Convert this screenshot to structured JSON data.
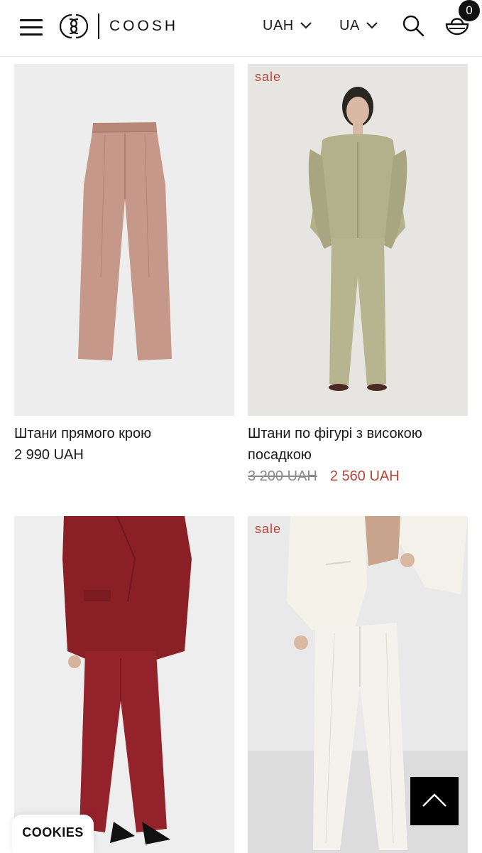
{
  "header": {
    "brand": "COOSH",
    "currency": "UAH",
    "language": "UA",
    "cart_count": "0"
  },
  "products": [
    {
      "name": "Штани прямого крою",
      "price": "2 990 UAH",
      "sale": false,
      "image": "dusty-pink-wide-trousers"
    },
    {
      "name": "Штани по фігурі з високою посадкою",
      "old_price": "3 200 UAH",
      "price": "2 560 UAH",
      "sale": true,
      "sale_label": "sale",
      "image": "olive-suit-model"
    },
    {
      "name": "",
      "price": "",
      "sale": false,
      "image": "burgundy-suit-model"
    },
    {
      "name": "",
      "price": "",
      "sale": true,
      "sale_label": "sale",
      "image": "white-flared-trousers-model"
    }
  ],
  "cookies_label": "COOKIES",
  "colors": {
    "accent_sale": "#b3453a",
    "text": "#1a1a1a",
    "strike": "#8a8a8a"
  },
  "icons": [
    "menu-icon",
    "coosh-logo-icon",
    "chevron-down-icon",
    "search-icon",
    "cart-icon",
    "arrow-up-icon"
  ]
}
